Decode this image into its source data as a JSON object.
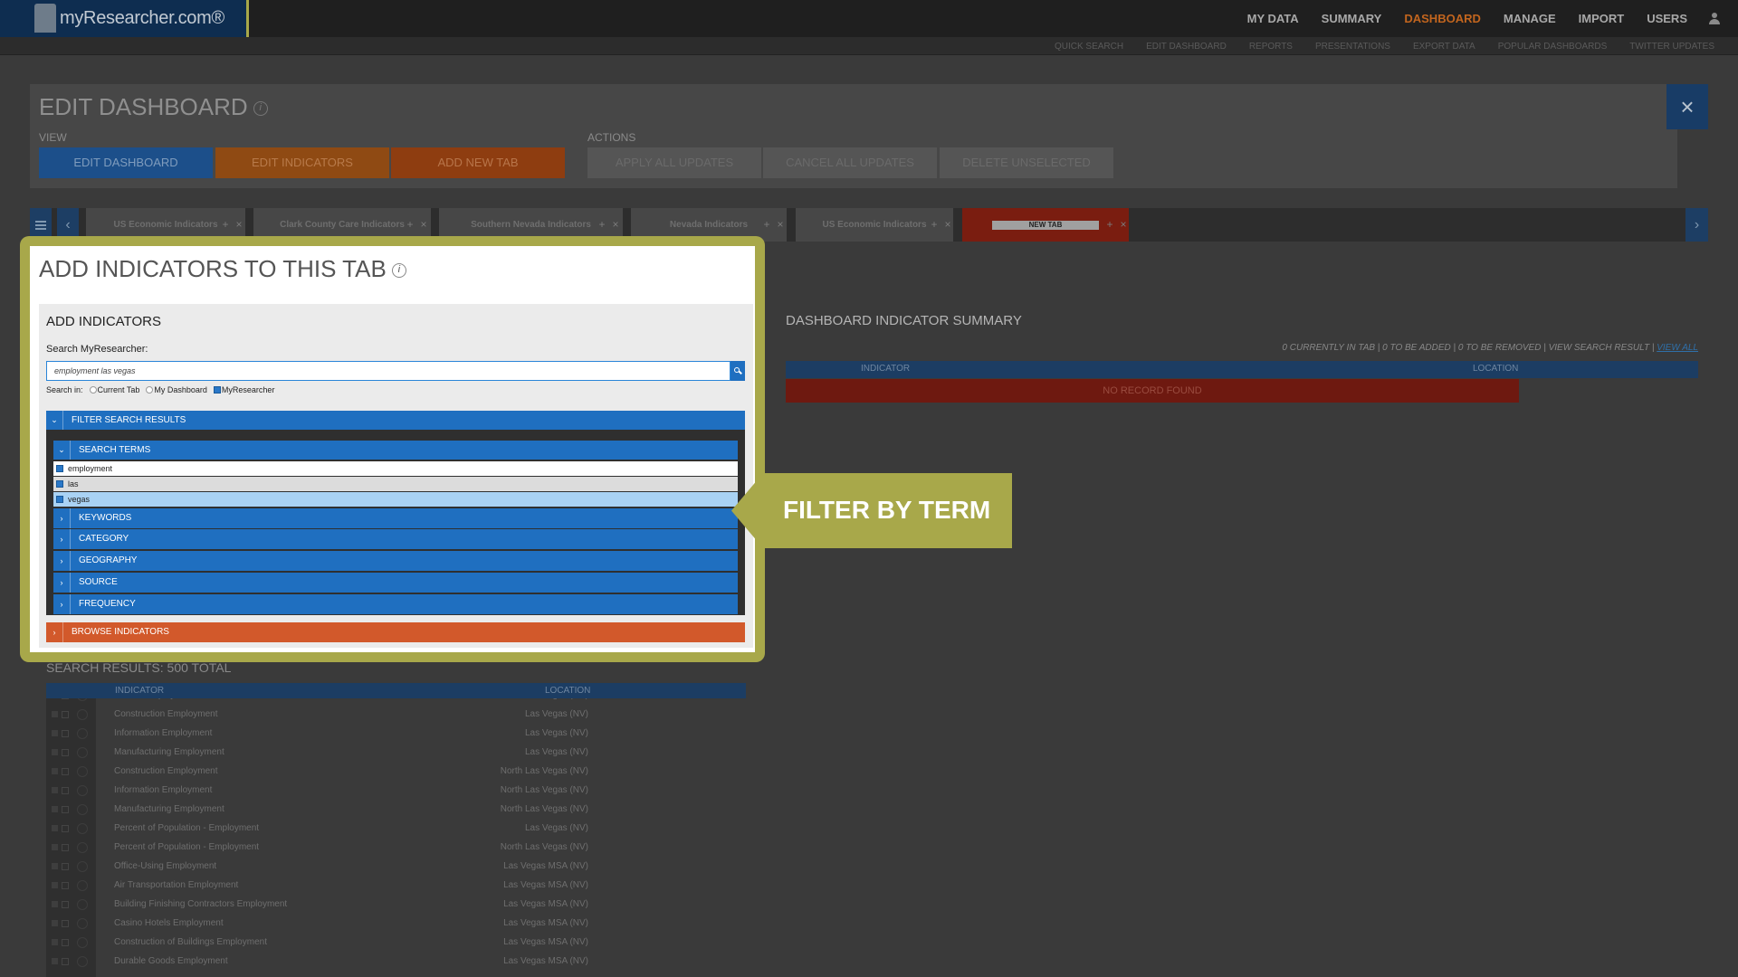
{
  "app": {
    "brand": "myResearcher.com®"
  },
  "main_nav": [
    "MY DATA",
    "SUMMARY",
    "DASHBOARD",
    "MANAGE",
    "IMPORT",
    "USERS"
  ],
  "sub_nav": [
    "QUICK SEARCH",
    "EDIT DASHBOARD",
    "REPORTS",
    "PRESENTATIONS",
    "EXPORT DATA",
    "POPULAR DASHBOARDS",
    "TWITTER UPDATES"
  ],
  "edit": {
    "title": "EDIT DASHBOARD",
    "view_label": "VIEW",
    "actions_label": "ACTIONS",
    "view_buttons": [
      "EDIT DASHBOARD",
      "EDIT INDICATORS",
      "ADD NEW TAB"
    ],
    "action_buttons": [
      "APPLY ALL UPDATES",
      "CANCEL ALL UPDATES",
      "DELETE UNSELECTED"
    ],
    "close_symbol": "×"
  },
  "tabs": [
    "US Economic Indicators",
    "Clark County Care Indicators",
    "Southern Nevada Indicators",
    "Nevada Indicators",
    "US Economic Indicators",
    "NEW TAB"
  ],
  "modal": {
    "title": "ADD INDICATORS TO THIS TAB",
    "section_title": "ADD INDICATORS",
    "search_label": "Search MyResearcher:",
    "search_value": "employment las vegas",
    "search_in_label": "Search in:",
    "search_in_options": [
      "Current Tab",
      "My Dashboard",
      "MyResearcher"
    ],
    "filter_label": "FILTER SEARCH RESULTS",
    "search_terms_label": "SEARCH TERMS",
    "terms": [
      "employment",
      "las",
      "vegas"
    ],
    "facets": [
      "KEYWORDS",
      "CATEGORY",
      "GEOGRAPHY",
      "SOURCE",
      "FREQUENCY"
    ],
    "browse_label": "BROWSE INDICATORS"
  },
  "callout": {
    "text": "FILTER BY TERM",
    "color": "#a8a84a"
  },
  "summary": {
    "title": "DASHBOARD INDICATOR SUMMARY",
    "counts": "0 CURRENTLY IN TAB | 0 TO BE ADDED | 0 TO BE REMOVED | VIEW SEARCH RESULT |",
    "view_all": "VIEW ALL",
    "col_indicator": "INDICATOR",
    "col_location": "LOCATION",
    "empty_text": "NO RECORD FOUND"
  },
  "results": {
    "title": "SEARCH RESULTS: 500 TOTAL",
    "col_indicator": "INDICATOR",
    "col_location": "LOCATION",
    "rows": [
      {
        "indicator": "Private Employment",
        "location": "Las Vegas (NV)"
      },
      {
        "indicator": "Construction Employment",
        "location": "Las Vegas (NV)"
      },
      {
        "indicator": "Information Employment",
        "location": "Las Vegas (NV)"
      },
      {
        "indicator": "Manufacturing Employment",
        "location": "Las Vegas (NV)"
      },
      {
        "indicator": "Construction Employment",
        "location": "North Las Vegas (NV)"
      },
      {
        "indicator": "Information Employment",
        "location": "North Las Vegas (NV)"
      },
      {
        "indicator": "Manufacturing Employment",
        "location": "North Las Vegas (NV)"
      },
      {
        "indicator": "Percent of Population - Employment",
        "location": "Las Vegas (NV)"
      },
      {
        "indicator": "Percent of Population - Employment",
        "location": "North Las Vegas (NV)"
      },
      {
        "indicator": "Office-Using Employment",
        "location": "Las Vegas MSA (NV)"
      },
      {
        "indicator": "Air Transportation Employment",
        "location": "Las Vegas MSA (NV)"
      },
      {
        "indicator": "Building Finishing Contractors Employment",
        "location": "Las Vegas MSA (NV)"
      },
      {
        "indicator": "Casino Hotels Employment",
        "location": "Las Vegas MSA (NV)"
      },
      {
        "indicator": "Construction of Buildings Employment",
        "location": "Las Vegas MSA (NV)"
      },
      {
        "indicator": "Durable Goods Employment",
        "location": "Las Vegas MSA (NV)"
      }
    ]
  },
  "colors": {
    "accent_blue": "#1f6fc0",
    "active_nav": "#c2651e",
    "browse_orange": "#d2592b",
    "edit_dashboard_btn": "#1c4f8a",
    "edit_indicators_btn": "#8f4a13",
    "add_new_tab_btn": "#8e3d10"
  }
}
